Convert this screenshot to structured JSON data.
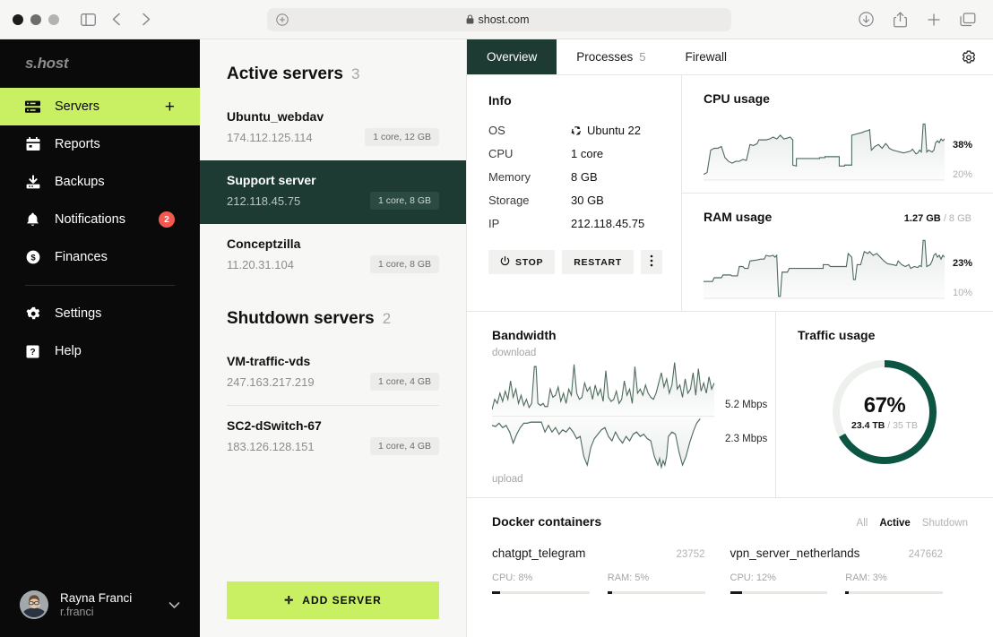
{
  "browser": {
    "url": "shost.com",
    "icons": {
      "sidebar_toggle": "sidebar-toggle-icon",
      "back": "back-icon",
      "forward": "forward-icon",
      "reader_plus": "extension-plus-icon",
      "lock": "lock-icon",
      "download": "download-icon",
      "share": "share-icon",
      "new_tab": "new-tab-icon",
      "tab_overview": "tab-overview-icon"
    }
  },
  "sidebar": {
    "brand": "s.host",
    "items": [
      {
        "label": "Servers",
        "icon": "server-icon",
        "active": true,
        "action": "plus"
      },
      {
        "label": "Reports",
        "icon": "calendar-icon",
        "active": false
      },
      {
        "label": "Backups",
        "icon": "backup-icon",
        "active": false
      },
      {
        "label": "Notifications",
        "icon": "bell-icon",
        "active": false,
        "badge": "2"
      },
      {
        "label": "Finances",
        "icon": "dollar-circle-icon",
        "active": false
      },
      {
        "label": "Settings",
        "icon": "gear-icon",
        "active": false
      },
      {
        "label": "Help",
        "icon": "question-square-icon",
        "active": false
      }
    ],
    "profile": {
      "name": "Rayna Franci",
      "handle": "r.franci"
    }
  },
  "server_list": {
    "active": {
      "title": "Active servers",
      "count": "3",
      "servers": [
        {
          "name": "Ubuntu_webdav",
          "ip": "174.112.125.114",
          "spec": "1 core, 12 GB",
          "selected": false
        },
        {
          "name": "Support server",
          "ip": "212.118.45.75",
          "spec": "1 core, 8 GB",
          "selected": true
        },
        {
          "name": "Conceptzilla",
          "ip": "11.20.31.104",
          "spec": "1 core, 8 GB",
          "selected": false
        }
      ]
    },
    "shutdown": {
      "title": "Shutdown servers",
      "count": "2",
      "servers": [
        {
          "name": "VM-traffic-vds",
          "ip": "247.163.217.219",
          "spec": "1 core, 4 GB",
          "selected": false
        },
        {
          "name": "SC2-dSwitch-67",
          "ip": "183.126.128.151",
          "spec": "1 core, 4 GB",
          "selected": false
        }
      ]
    },
    "add_button": "ADD SERVER"
  },
  "tabs": [
    {
      "label": "Overview",
      "count": "",
      "active": true
    },
    {
      "label": "Processes",
      "count": "5",
      "active": false
    },
    {
      "label": "Firewall",
      "count": "",
      "active": false
    }
  ],
  "settings_icon": "gear-icon",
  "info": {
    "title": "Info",
    "rows": [
      {
        "key": "OS",
        "value": "Ubuntu 22",
        "icon": "ubuntu-icon"
      },
      {
        "key": "CPU",
        "value": "1 core",
        "icon": ""
      },
      {
        "key": "Memory",
        "value": "8 GB",
        "icon": ""
      },
      {
        "key": "Storage",
        "value": "30 GB",
        "icon": ""
      },
      {
        "key": "IP",
        "value": "212.118.45.75",
        "icon": ""
      }
    ],
    "actions": {
      "stop": "STOP",
      "restart": "RESTART",
      "more": "more-icon"
    }
  },
  "cpu_usage": {
    "title": "CPU usage",
    "current": "38%",
    "baseline": "20%"
  },
  "ram_usage": {
    "title": "RAM usage",
    "used": "1.27 GB",
    "total": "/ 8 GB",
    "current": "23%",
    "baseline": "10%"
  },
  "bandwidth": {
    "title": "Bandwidth",
    "download_label": "download",
    "upload_label": "upload",
    "download_rate": "5.2 Mbps",
    "upload_rate": "2.3 Mbps"
  },
  "traffic": {
    "title": "Traffic usage",
    "percent": "67%",
    "used": "23.4 TB",
    "total": "/ 35 TB"
  },
  "docker": {
    "title": "Docker containers",
    "filters": [
      {
        "label": "All",
        "active": false
      },
      {
        "label": "Active",
        "active": true
      },
      {
        "label": "Shutdown",
        "active": false
      }
    ],
    "containers": [
      {
        "name": "chatgpt_telegram",
        "id": "23752",
        "cpu_label": "CPU: 8%",
        "cpu_pct": 8,
        "ram_label": "RAM: 5%",
        "ram_pct": 5
      },
      {
        "name": "vpn_server_netherlands",
        "id": "247662",
        "cpu_label": "CPU: 12%",
        "cpu_pct": 12,
        "ram_label": "RAM: 3%",
        "ram_pct": 3
      }
    ]
  },
  "chart_data": [
    {
      "type": "line",
      "title": "CPU usage",
      "ylabel": "%",
      "ylim": [
        20,
        38
      ],
      "tick_labels": [
        "38%",
        "20%"
      ],
      "values": [
        20,
        29,
        31,
        27,
        23,
        24,
        23,
        24,
        30,
        31,
        30,
        33,
        34,
        33,
        35,
        34,
        33,
        33,
        32,
        32,
        22,
        23,
        23,
        23,
        23,
        24,
        24,
        23,
        21,
        21,
        21,
        21,
        21,
        22,
        30,
        34,
        33,
        36,
        37,
        36,
        30,
        31,
        32,
        34,
        33,
        31,
        32,
        31,
        30,
        30,
        29,
        29,
        30,
        29,
        30,
        30,
        31,
        29,
        30,
        36,
        29,
        29,
        30,
        30,
        32,
        33,
        34,
        33,
        34,
        35,
        36,
        38
      ]
    },
    {
      "type": "line",
      "title": "RAM usage",
      "ylabel": "%",
      "ylim": [
        10,
        23
      ],
      "tick_labels": [
        "23%",
        "10%"
      ],
      "values": [
        13,
        13,
        14,
        14,
        15,
        15,
        15,
        16,
        16,
        18,
        18,
        19,
        20,
        20,
        21,
        21,
        21,
        22,
        21,
        10,
        12,
        17,
        17,
        17,
        18,
        18,
        18,
        18,
        19,
        19,
        19,
        19,
        19,
        19,
        19,
        20,
        20,
        21,
        20,
        16,
        17,
        19,
        20,
        21,
        21,
        20,
        20,
        19,
        18,
        18,
        18,
        18,
        19,
        18,
        19,
        18,
        19,
        23,
        18,
        18,
        19,
        20,
        21,
        21,
        20,
        21,
        20,
        21,
        21,
        22,
        22,
        23
      ]
    },
    {
      "type": "line",
      "title": "Bandwidth",
      "series": [
        {
          "name": "download",
          "current": "5.2 Mbps",
          "unit": "Mbps",
          "value": 5.2
        },
        {
          "name": "upload",
          "current": "2.3 Mbps",
          "unit": "Mbps",
          "value": 2.3
        }
      ]
    },
    {
      "type": "pie",
      "title": "Traffic usage",
      "categories": [
        "used",
        "free"
      ],
      "values": [
        67,
        33
      ],
      "labels": [
        "23.4 TB",
        "35 TB"
      ],
      "center_label": "67%"
    }
  ],
  "colors": {
    "accent_green": "#c9ef63",
    "dark_green": "#1e3b33",
    "sidebar_black": "#0a0a0a",
    "chart_green": "#4e6b5c",
    "badge_red": "#f4594f"
  }
}
